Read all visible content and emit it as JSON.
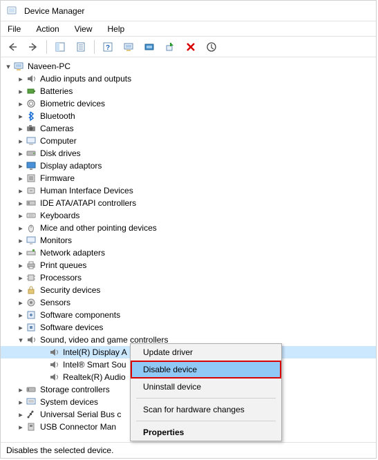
{
  "title": "Device Manager",
  "menubar": [
    "File",
    "Action",
    "View",
    "Help"
  ],
  "status": "Disables the selected device.",
  "root": "Naveen-PC",
  "categories": [
    {
      "label": "Audio inputs and outputs",
      "icon": "audio"
    },
    {
      "label": "Batteries",
      "icon": "battery"
    },
    {
      "label": "Biometric devices",
      "icon": "biometric"
    },
    {
      "label": "Bluetooth",
      "icon": "bluetooth"
    },
    {
      "label": "Cameras",
      "icon": "camera"
    },
    {
      "label": "Computer",
      "icon": "computer"
    },
    {
      "label": "Disk drives",
      "icon": "disk"
    },
    {
      "label": "Display adaptors",
      "icon": "display"
    },
    {
      "label": "Firmware",
      "icon": "firmware"
    },
    {
      "label": "Human Interface Devices",
      "icon": "hid"
    },
    {
      "label": "IDE ATA/ATAPI controllers",
      "icon": "ide"
    },
    {
      "label": "Keyboards",
      "icon": "keyboard"
    },
    {
      "label": "Mice and other pointing devices",
      "icon": "mouse"
    },
    {
      "label": "Monitors",
      "icon": "monitor"
    },
    {
      "label": "Network adapters",
      "icon": "network"
    },
    {
      "label": "Print queues",
      "icon": "print"
    },
    {
      "label": "Processors",
      "icon": "cpu"
    },
    {
      "label": "Security devices",
      "icon": "security"
    },
    {
      "label": "Sensors",
      "icon": "sensor"
    },
    {
      "label": "Software components",
      "icon": "softcomp"
    },
    {
      "label": "Software devices",
      "icon": "softdev"
    },
    {
      "label": "Sound, video and game controllers",
      "icon": "sound",
      "expanded": true,
      "children": [
        {
          "label": "Intel(R) Display A",
          "icon": "audio",
          "selected": true
        },
        {
          "label": "Intel® Smart Sou",
          "icon": "audio"
        },
        {
          "label": "Realtek(R) Audio",
          "icon": "audio"
        }
      ]
    },
    {
      "label": "Storage controllers",
      "icon": "storage"
    },
    {
      "label": "System devices",
      "icon": "system"
    },
    {
      "label": "Universal Serial Bus c",
      "icon": "usb"
    },
    {
      "label": "USB Connector Man",
      "icon": "usbconn"
    }
  ],
  "context_menu": [
    {
      "label": "Update driver"
    },
    {
      "label": "Disable device",
      "highlight": true
    },
    {
      "label": "Uninstall device"
    },
    {
      "sep": true
    },
    {
      "label": "Scan for hardware changes"
    },
    {
      "sep": true
    },
    {
      "label": "Properties",
      "bold": true
    }
  ]
}
